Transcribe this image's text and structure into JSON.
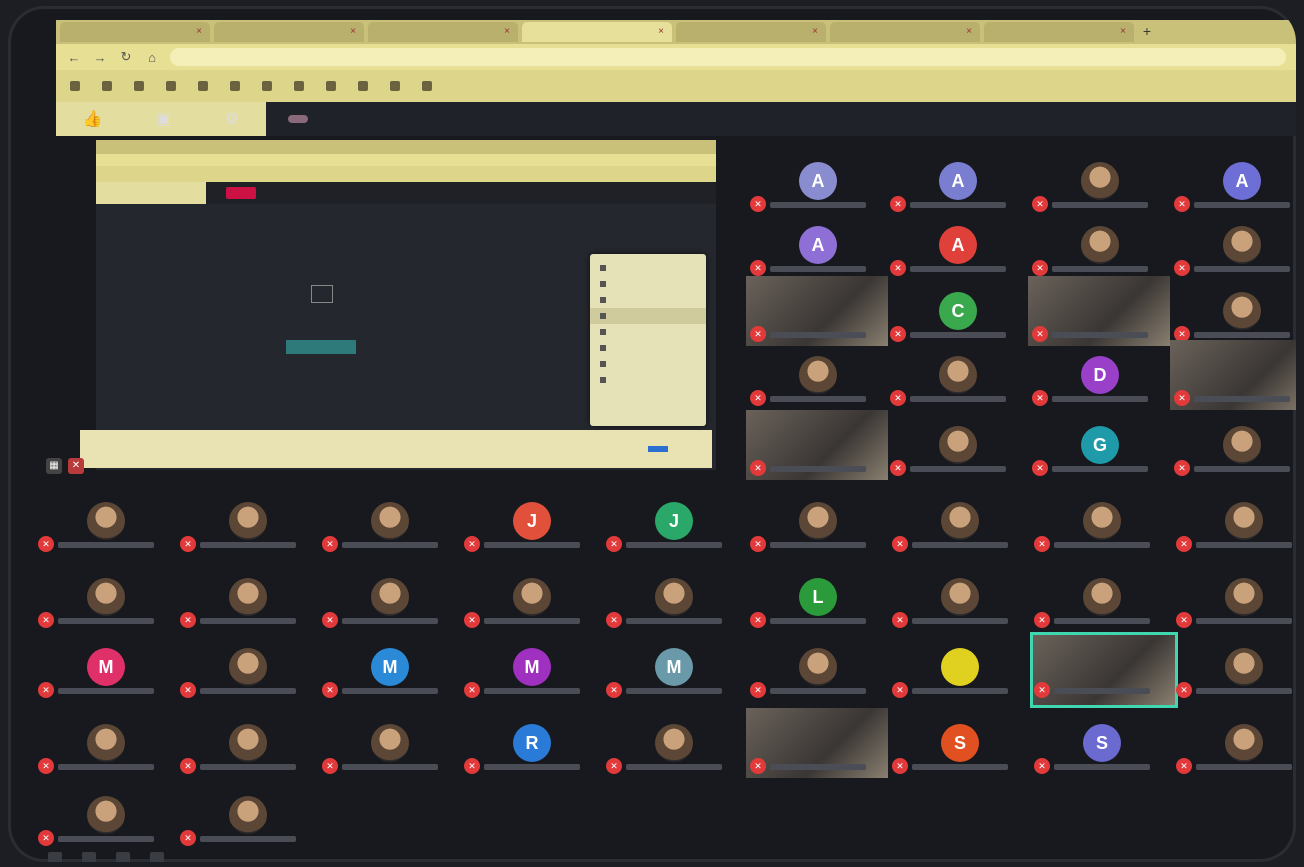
{
  "browser": {
    "tabs": [
      {
        "title": "",
        "active": false
      },
      {
        "title": "",
        "active": false
      },
      {
        "title": "",
        "active": false
      },
      {
        "title": "",
        "active": true
      },
      {
        "title": "",
        "active": false
      },
      {
        "title": "",
        "active": false
      },
      {
        "title": "",
        "active": false
      }
    ],
    "url": "",
    "bookmarks": [
      "",
      "",
      "",
      "",
      "",
      "",
      "",
      "",
      "",
      "",
      "",
      ""
    ]
  },
  "zoom_top": {
    "rec_label": "",
    "sharing_text": ""
  },
  "inner": {
    "message": "",
    "context_menu": [
      "",
      "",
      "",
      "",
      "",
      "",
      "",
      ""
    ]
  },
  "notification": {
    "text": "",
    "button": "",
    "actions": [
      "",
      ""
    ]
  },
  "participants": [
    {
      "letter": "A",
      "color": "#8a8cd0"
    },
    {
      "letter": "A",
      "color": "#7a7ed0"
    },
    {
      "letter": "",
      "color": "photo"
    },
    {
      "letter": "A",
      "color": "#6d6fd6"
    },
    {
      "letter": "A",
      "color": "#8d6fd6"
    },
    {
      "letter": "A",
      "color": "#e0403a"
    },
    {
      "letter": "",
      "color": "photo"
    },
    {
      "letter": "",
      "color": "photo"
    },
    {
      "letter": "",
      "color": "video"
    },
    {
      "letter": "C",
      "color": "#3aa84c"
    },
    {
      "letter": "",
      "color": "video"
    },
    {
      "letter": "",
      "color": "photo"
    },
    {
      "letter": "",
      "color": "photo"
    },
    {
      "letter": "",
      "color": "photo"
    },
    {
      "letter": "D",
      "color": "#9a40c8"
    },
    {
      "letter": "",
      "color": "video"
    },
    {
      "letter": "",
      "color": "video"
    },
    {
      "letter": "",
      "color": "photo"
    },
    {
      "letter": "G",
      "color": "#1e9aa8"
    },
    {
      "letter": "",
      "color": "photo"
    }
  ],
  "bottom_rows": [
    [
      {
        "letter": "",
        "t": "photo"
      },
      {
        "letter": "",
        "t": "photo"
      },
      {
        "letter": "",
        "t": "photo"
      },
      {
        "letter": "J",
        "t": "#e0503a"
      },
      {
        "letter": "J",
        "t": "#2aa86a"
      },
      {
        "letter": "",
        "t": "photo"
      },
      {
        "letter": "",
        "t": "photo"
      },
      {
        "letter": "",
        "t": "photo"
      },
      {
        "letter": "",
        "t": "photo"
      }
    ],
    [
      {
        "letter": "",
        "t": "photo"
      },
      {
        "letter": "",
        "t": "photo"
      },
      {
        "letter": "",
        "t": "photo"
      },
      {
        "letter": "",
        "t": "photo"
      },
      {
        "letter": "",
        "t": "photo"
      },
      {
        "letter": "L",
        "t": "#2a9a3a"
      },
      {
        "letter": "",
        "t": "photo"
      },
      {
        "letter": "",
        "t": "photo"
      },
      {
        "letter": "",
        "t": "photo"
      }
    ],
    [
      {
        "letter": "M",
        "t": "#e0306a"
      },
      {
        "letter": "",
        "t": "photo"
      },
      {
        "letter": "M",
        "t": "#2a8ad8"
      },
      {
        "letter": "M",
        "t": "#a030c0"
      },
      {
        "letter": "M",
        "t": "#6a9aaa"
      },
      {
        "letter": "",
        "t": "photo"
      },
      {
        "letter": "",
        "t": "#e0d020"
      },
      {
        "letter": "",
        "t": "video"
      },
      {
        "letter": "",
        "t": "photo"
      }
    ],
    [
      {
        "letter": "",
        "t": "photo"
      },
      {
        "letter": "",
        "t": "photo"
      },
      {
        "letter": "",
        "t": "photo"
      },
      {
        "letter": "R",
        "t": "#2a7ad8"
      },
      {
        "letter": "",
        "t": "photo"
      },
      {
        "letter": "",
        "t": "video"
      },
      {
        "letter": "S",
        "t": "#e05020"
      },
      {
        "letter": "S",
        "t": "#6a6ad0"
      },
      {
        "letter": "",
        "t": "photo"
      }
    ],
    [
      {
        "letter": "",
        "t": "photo"
      },
      {
        "letter": "",
        "t": "photo"
      }
    ]
  ]
}
